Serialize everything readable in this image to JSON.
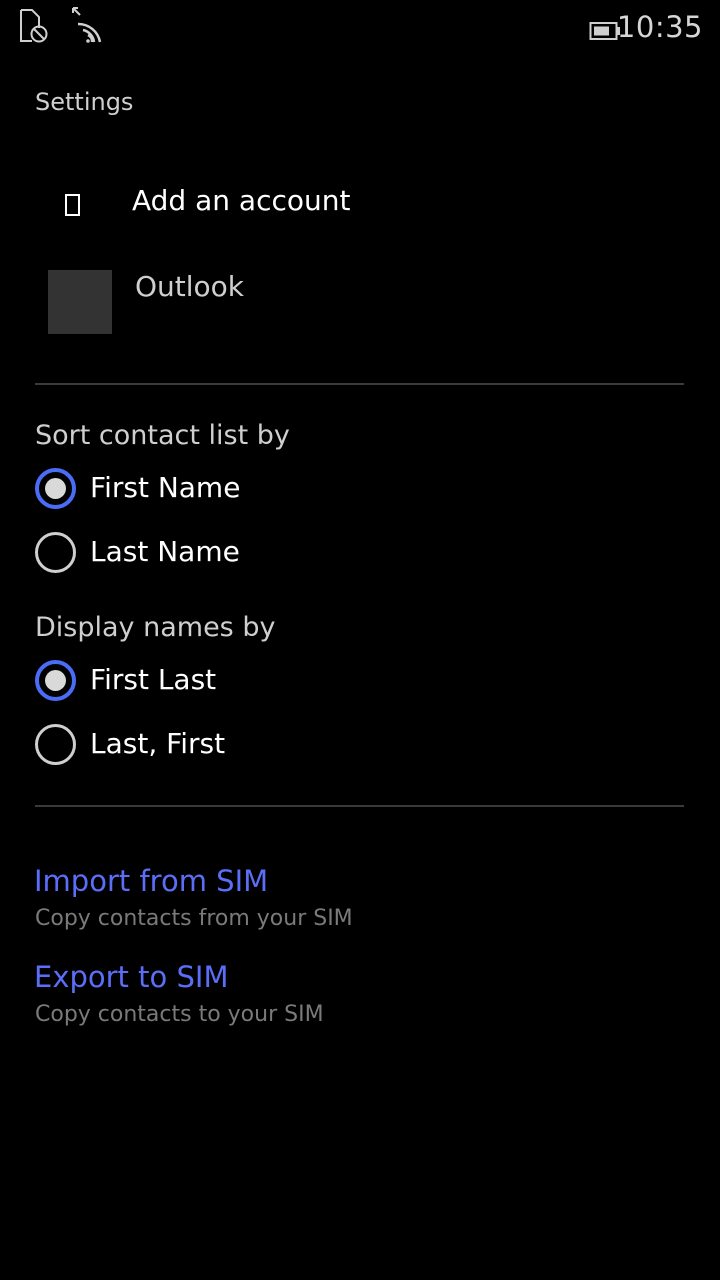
{
  "status_bar": {
    "time": "10:35",
    "icons": [
      "no-sim-icon",
      "wifi-signal-icon",
      "battery-icon"
    ]
  },
  "page": {
    "title": "Settings"
  },
  "accounts": {
    "add_account_label": "Add an account",
    "items": [
      {
        "label": "Outlook"
      }
    ]
  },
  "sort": {
    "label": "Sort contact list by",
    "options": [
      {
        "label": "First Name",
        "selected": true
      },
      {
        "label": "Last Name",
        "selected": false
      }
    ]
  },
  "display": {
    "label": "Display names by",
    "options": [
      {
        "label": "First Last",
        "selected": true
      },
      {
        "label": "Last, First",
        "selected": false
      }
    ]
  },
  "actions": [
    {
      "title": "Import from SIM",
      "subtitle": "Copy contacts from your SIM"
    },
    {
      "title": "Export to SIM",
      "subtitle": "Copy contacts to your SIM"
    }
  ],
  "colors": {
    "accent": "#4a6cf7",
    "link": "#5b6ef8",
    "background": "#000000"
  }
}
